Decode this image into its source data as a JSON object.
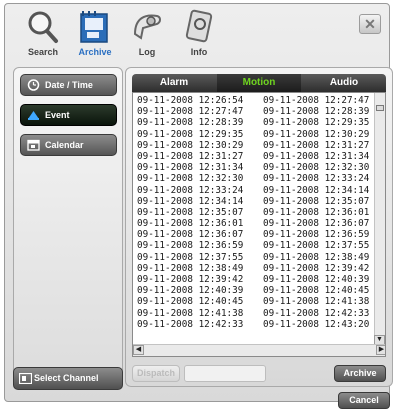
{
  "toolbar": {
    "tools": [
      {
        "label": "Search",
        "icon": "magnifier-icon"
      },
      {
        "label": "Archive",
        "icon": "film-archive-icon",
        "active": true
      },
      {
        "label": "Log",
        "icon": "log-icon"
      },
      {
        "label": "Info",
        "icon": "info-icon"
      }
    ],
    "close_label": "✕"
  },
  "sidebar": {
    "items": [
      {
        "label": "Date / Time",
        "icon": "clock-icon"
      },
      {
        "label": "Event",
        "icon": "event-icon",
        "selected": true
      },
      {
        "label": "Calendar",
        "icon": "calendar-icon"
      }
    ],
    "select_channel_label": "Select Channel"
  },
  "tabs": [
    {
      "label": "Alarm"
    },
    {
      "label": "Motion",
      "active": true
    },
    {
      "label": "Audio"
    }
  ],
  "events": [
    [
      "09-11-2008 12:26:54",
      "09-11-2008 12:27:47"
    ],
    [
      "09-11-2008 12:27:47",
      "09-11-2008 12:28:39"
    ],
    [
      "09-11-2008 12:28:39",
      "09-11-2008 12:29:35"
    ],
    [
      "09-11-2008 12:29:35",
      "09-11-2008 12:30:29"
    ],
    [
      "09-11-2008 12:30:29",
      "09-11-2008 12:31:27"
    ],
    [
      "09-11-2008 12:31:27",
      "09-11-2008 12:31:34"
    ],
    [
      "09-11-2008 12:31:34",
      "09-11-2008 12:32:30"
    ],
    [
      "09-11-2008 12:32:30",
      "09-11-2008 12:33:24"
    ],
    [
      "09-11-2008 12:33:24",
      "09-11-2008 12:34:14"
    ],
    [
      "09-11-2008 12:34:14",
      "09-11-2008 12:35:07"
    ],
    [
      "09-11-2008 12:35:07",
      "09-11-2008 12:36:01"
    ],
    [
      "09-11-2008 12:36:01",
      "09-11-2008 12:36:07"
    ],
    [
      "09-11-2008 12:36:07",
      "09-11-2008 12:36:59"
    ],
    [
      "09-11-2008 12:36:59",
      "09-11-2008 12:37:55"
    ],
    [
      "09-11-2008 12:37:55",
      "09-11-2008 12:38:49"
    ],
    [
      "09-11-2008 12:38:49",
      "09-11-2008 12:39:42"
    ],
    [
      "09-11-2008 12:39:42",
      "09-11-2008 12:40:39"
    ],
    [
      "09-11-2008 12:40:39",
      "09-11-2008 12:40:45"
    ],
    [
      "09-11-2008 12:40:45",
      "09-11-2008 12:41:38"
    ],
    [
      "09-11-2008 12:41:38",
      "09-11-2008 12:42:33"
    ],
    [
      "09-11-2008 12:42:33",
      "09-11-2008 12:43:20"
    ]
  ],
  "actions": {
    "disabled_button_label": "Dispatch",
    "archive_label": "Archive",
    "cancel_label": "Cancel"
  },
  "colors": {
    "active_tab_text": "#6fd41f",
    "active_tool_text": "#2a6fc2"
  }
}
